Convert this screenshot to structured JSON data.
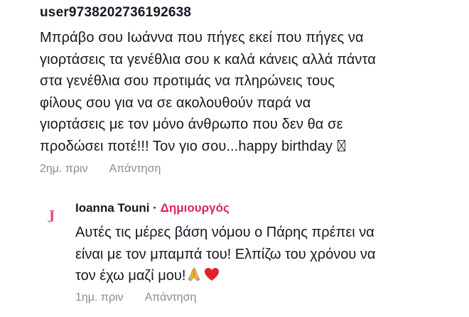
{
  "comment": {
    "username": "user9738202736192638",
    "lines": [
      "Μπράβο σου Ιωάννα που πήγες εκεί που πήγες να",
      "γιορτάσεις τα γενέθλια σου κ καλά κάνεις αλλά πάντα",
      "στα γενέθλια σου προτιμάς να πληρώνεις τους",
      "φίλους σου για να σε ακολουθούν παρά να",
      "γιορτάσεις με τον μόνο άνθρωπο που δεν θα σε",
      "προδώσει ποτέ!!! Τον γιο σου...happy birthday"
    ],
    "time": "2ημ. πριν",
    "reply_label": "Απάντηση"
  },
  "reply": {
    "avatar_letter": "J",
    "author": "Ioanna Touni",
    "separator": "·",
    "creator_badge": "Δημιουργός",
    "lines": [
      "Αυτές τις μέρες βάση νόμου ο Πάρης πρέπει να",
      "είναι με τον μπαμπά του! Ελπίζω του χρόνου να",
      "τον έχω μαζί μου!"
    ],
    "emojis": [
      "folded-hands-icon",
      "red-heart-icon"
    ],
    "time": "1ημ. πριν",
    "reply_label": "Απάντηση"
  },
  "colors": {
    "text": "#161823",
    "meta": "#8a8b91",
    "creator": "#e0245e",
    "avatar": "#e84a8a"
  }
}
